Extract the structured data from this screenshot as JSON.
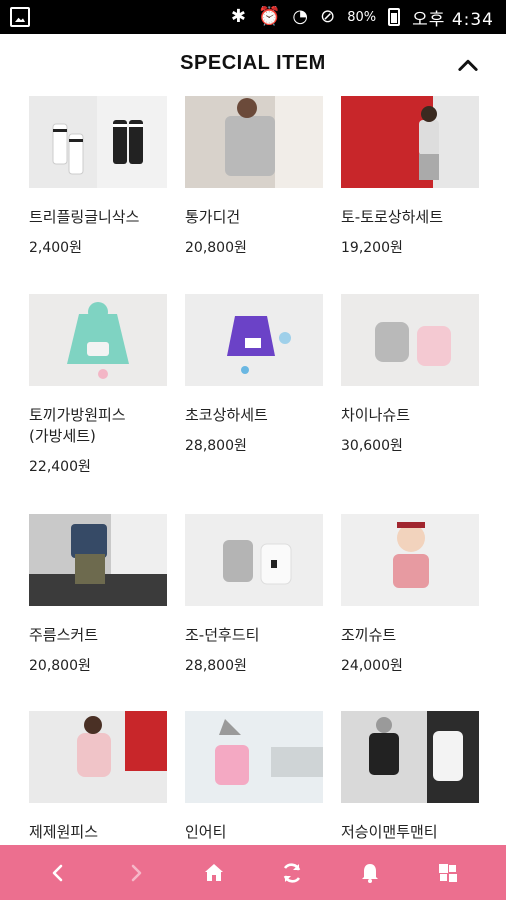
{
  "status_bar": {
    "battery_percent": "80%",
    "time": "오후 4:34",
    "icons": [
      "gallery-icon",
      "bluetooth-icon",
      "alarm-icon",
      "wifi-icon",
      "do-not-disturb-icon",
      "battery-icon"
    ]
  },
  "header": {
    "title": "SPECIAL ITEM",
    "collapse_icon": "chevron-up-icon"
  },
  "products": [
    {
      "name": "트리플링글니삭스",
      "price": "2,400원"
    },
    {
      "name": "통가디건",
      "price": "20,800원"
    },
    {
      "name": "토-토로상하세트",
      "price": "19,200원"
    },
    {
      "name": "토끼가방원피스\n(가방세트)",
      "price": "22,400원"
    },
    {
      "name": "초코상하세트",
      "price": "28,800원"
    },
    {
      "name": "차이나슈트",
      "price": "30,600원"
    },
    {
      "name": "주름스커트",
      "price": "20,800원"
    },
    {
      "name": "조-던후드티",
      "price": "28,800원"
    },
    {
      "name": "조끼슈트",
      "price": "24,000원"
    },
    {
      "name": "제제원피스",
      "price": ""
    },
    {
      "name": "인어티",
      "price": ""
    },
    {
      "name": "저승이맨투맨티",
      "price": ""
    }
  ],
  "bottom_nav": {
    "background": "#ec6f8f",
    "buttons": [
      "back-icon",
      "forward-icon",
      "home-icon",
      "refresh-icon",
      "bell-icon",
      "grid-icon"
    ]
  }
}
